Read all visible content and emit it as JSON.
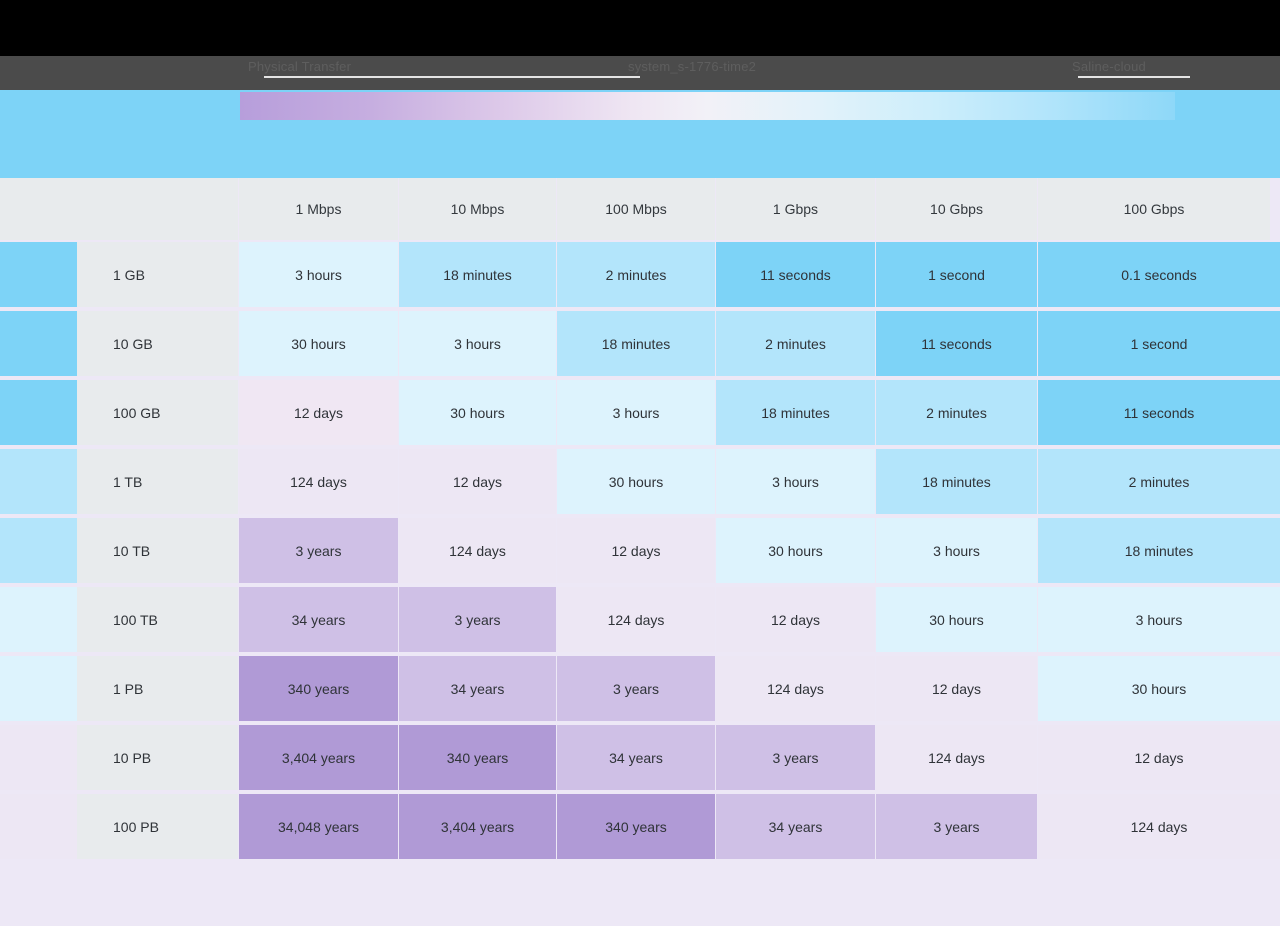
{
  "browser": {
    "tab_title": "Physical Transfer",
    "address_text": "system_s-1776-time2",
    "right_label": "Saline-cloud"
  },
  "banner": {
    "color": "#7dd3f7",
    "gradient_from": "#b79edb",
    "gradient_to": "#8ed8f8"
  },
  "table": {
    "corner_label": "",
    "column_headers": [
      "1 Mbps",
      "10 Mbps",
      "100 Mbps",
      "1 Gbps",
      "10 Gbps",
      "100 Gbps"
    ],
    "row_headers": [
      "1 GB",
      "10 GB",
      "100 GB",
      "1 TB",
      "10 TB",
      "100 TB",
      "1 PB",
      "10 PB",
      "100 PB"
    ],
    "rows": [
      {
        "label": "1 GB",
        "stripe": "#7dd3f7",
        "cells": [
          {
            "text": "3 hours",
            "bg": "#ddf3fd"
          },
          {
            "text": "18 minutes",
            "bg": "#b3e5fb"
          },
          {
            "text": "2 minutes",
            "bg": "#b3e5fb"
          },
          {
            "text": "11 seconds",
            "bg": "#7dd3f7"
          },
          {
            "text": "1 second",
            "bg": "#7dd3f7"
          },
          {
            "text": "0.1 seconds",
            "bg": "#7dd3f7"
          }
        ]
      },
      {
        "label": "10 GB",
        "stripe": "#7dd3f7",
        "cells": [
          {
            "text": "30 hours",
            "bg": "#ddf3fd"
          },
          {
            "text": "3 hours",
            "bg": "#ddf3fd"
          },
          {
            "text": "18 minutes",
            "bg": "#b3e5fb"
          },
          {
            "text": "2 minutes",
            "bg": "#b3e5fb"
          },
          {
            "text": "11 seconds",
            "bg": "#7dd3f7"
          },
          {
            "text": "1 second",
            "bg": "#7dd3f7"
          }
        ]
      },
      {
        "label": "100 GB",
        "stripe": "#7dd3f7",
        "cells": [
          {
            "text": "12 days",
            "bg": "#f0e7f3"
          },
          {
            "text": "30 hours",
            "bg": "#ddf3fd"
          },
          {
            "text": "3 hours",
            "bg": "#ddf3fd"
          },
          {
            "text": "18 minutes",
            "bg": "#b3e5fb"
          },
          {
            "text": "2 minutes",
            "bg": "#b3e5fb"
          },
          {
            "text": "11 seconds",
            "bg": "#7dd3f7"
          }
        ]
      },
      {
        "label": "1 TB",
        "stripe": "#b3e5fb",
        "cells": [
          {
            "text": "124 days",
            "bg": "#ede7f4"
          },
          {
            "text": "12 days",
            "bg": "#ede7f4"
          },
          {
            "text": "30 hours",
            "bg": "#ddf3fd"
          },
          {
            "text": "3 hours",
            "bg": "#ddf3fd"
          },
          {
            "text": "18 minutes",
            "bg": "#b3e5fb"
          },
          {
            "text": "2 minutes",
            "bg": "#b3e5fb"
          }
        ]
      },
      {
        "label": "10 TB",
        "stripe": "#b3e5fb",
        "cells": [
          {
            "text": "3 years",
            "bg": "#cfc0e6"
          },
          {
            "text": "124 days",
            "bg": "#ede7f4"
          },
          {
            "text": "12 days",
            "bg": "#ede7f4"
          },
          {
            "text": "30 hours",
            "bg": "#ddf3fd"
          },
          {
            "text": "3 hours",
            "bg": "#ddf3fd"
          },
          {
            "text": "18 minutes",
            "bg": "#b3e5fb"
          }
        ]
      },
      {
        "label": "100 TB",
        "stripe": "#ddf3fd",
        "cells": [
          {
            "text": "34 years",
            "bg": "#cfc0e6"
          },
          {
            "text": "3 years",
            "bg": "#cfc0e6"
          },
          {
            "text": "124 days",
            "bg": "#ede7f4"
          },
          {
            "text": "12 days",
            "bg": "#ede7f4"
          },
          {
            "text": "30 hours",
            "bg": "#ddf3fd"
          },
          {
            "text": "3 hours",
            "bg": "#ddf3fd"
          }
        ]
      },
      {
        "label": "1 PB",
        "stripe": "#ddf3fd",
        "cells": [
          {
            "text": "340 years",
            "bg": "#b09ad6"
          },
          {
            "text": "34 years",
            "bg": "#cfc0e6"
          },
          {
            "text": "3 years",
            "bg": "#cfc0e6"
          },
          {
            "text": "124 days",
            "bg": "#ede7f4"
          },
          {
            "text": "12 days",
            "bg": "#ede7f4"
          },
          {
            "text": "30 hours",
            "bg": "#ddf3fd"
          }
        ]
      },
      {
        "label": "10 PB",
        "stripe": "#ede7f4",
        "cells": [
          {
            "text": "3,404 years",
            "bg": "#b09ad6"
          },
          {
            "text": "340 years",
            "bg": "#b09ad6"
          },
          {
            "text": "34 years",
            "bg": "#cfc0e6"
          },
          {
            "text": "3 years",
            "bg": "#cfc0e6"
          },
          {
            "text": "124 days",
            "bg": "#ede7f4"
          },
          {
            "text": "12 days",
            "bg": "#ede7f4"
          }
        ]
      },
      {
        "label": "100 PB",
        "stripe": "#ede7f4",
        "cells": [
          {
            "text": "34,048 years",
            "bg": "#b09ad6"
          },
          {
            "text": "3,404 years",
            "bg": "#b09ad6"
          },
          {
            "text": "340 years",
            "bg": "#b09ad6"
          },
          {
            "text": "34 years",
            "bg": "#cfc0e6"
          },
          {
            "text": "3 years",
            "bg": "#cfc0e6"
          },
          {
            "text": "124 days",
            "bg": "#ede7f4"
          }
        ]
      }
    ]
  },
  "page": {
    "background": "#ede8f6"
  }
}
